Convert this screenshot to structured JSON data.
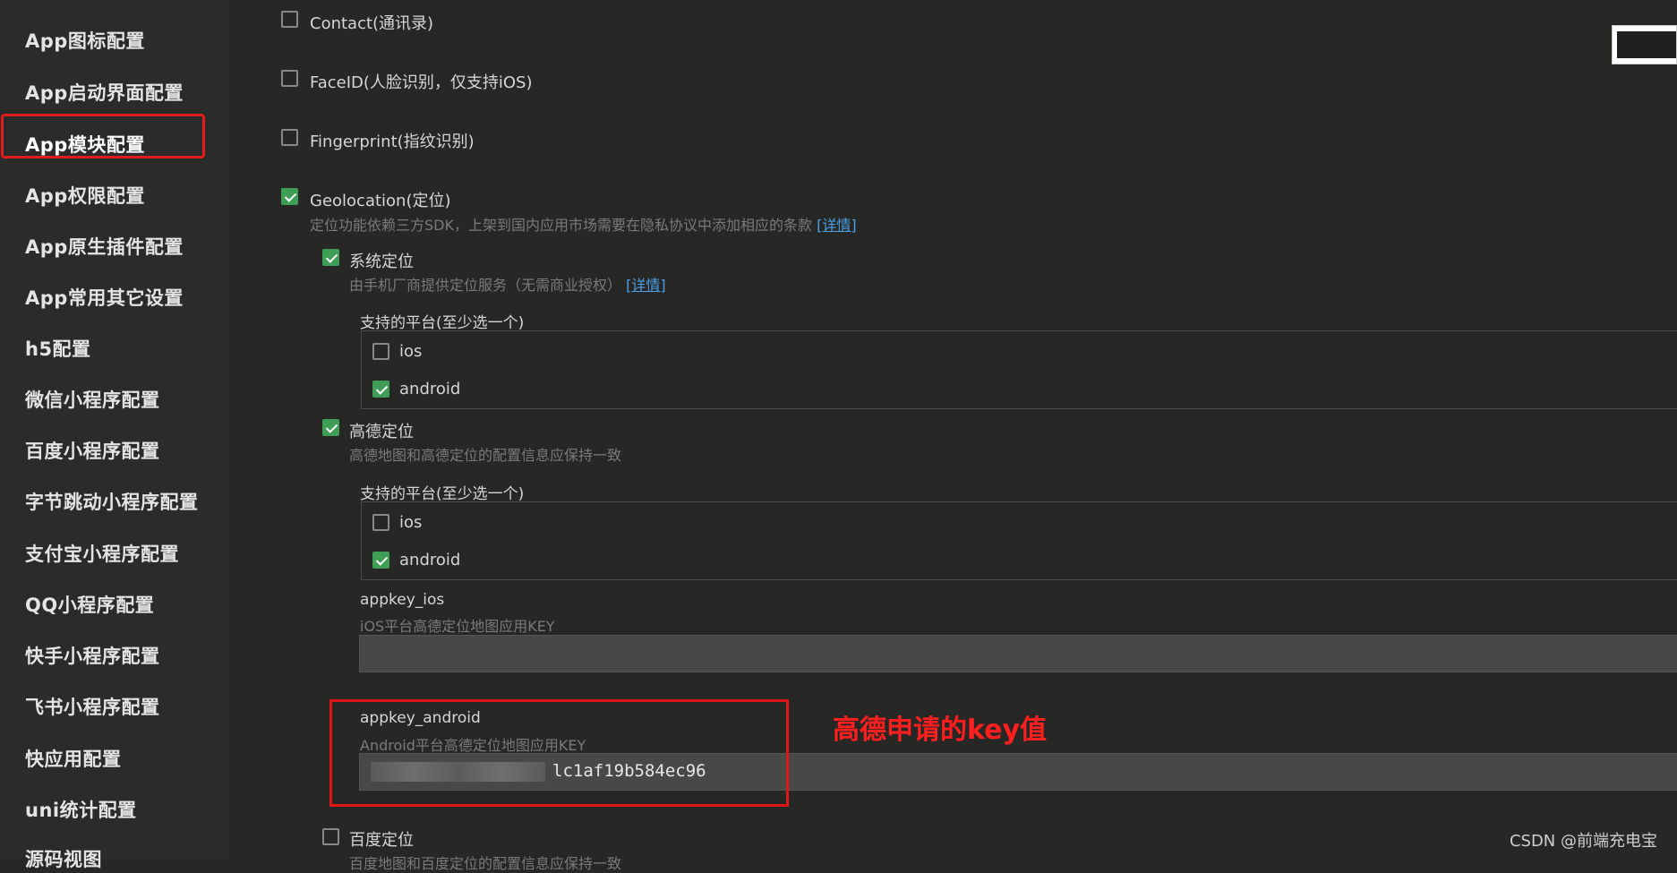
{
  "sidebar": {
    "items": [
      {
        "label": "App图标配置"
      },
      {
        "label": "App启动界面配置"
      },
      {
        "label": "App模块配置"
      },
      {
        "label": "App权限配置"
      },
      {
        "label": "App原生插件配置"
      },
      {
        "label": "App常用其它设置"
      },
      {
        "label": "h5配置"
      },
      {
        "label": "微信小程序配置"
      },
      {
        "label": "百度小程序配置"
      },
      {
        "label": "字节跳动小程序配置"
      },
      {
        "label": "支付宝小程序配置"
      },
      {
        "label": "QQ小程序配置"
      },
      {
        "label": "快手小程序配置"
      },
      {
        "label": "飞书小程序配置"
      },
      {
        "label": "快应用配置"
      },
      {
        "label": "uni统计配置"
      },
      {
        "label": "源码视图"
      }
    ]
  },
  "modules": {
    "contact": {
      "label": "Contact(通讯录)",
      "checked": false
    },
    "faceid": {
      "label": "FaceID(人脸识别，仅支持iOS)",
      "checked": false
    },
    "fingerprint": {
      "label": "Fingerprint(指纹识别)",
      "checked": false
    },
    "geolocation": {
      "label": "Geolocation(定位)",
      "checked": true,
      "desc": "定位功能依赖三方SDK，上架到国内应用市场需要在隐私协议中添加相应的条款",
      "link": "[详情]"
    }
  },
  "system_location": {
    "label": "系统定位",
    "checked": true,
    "desc": "由手机厂商提供定位服务（无需商业授权）",
    "link": "[详情]",
    "platforms_title": "支持的平台(至少选一个)",
    "ios": {
      "label": "ios",
      "checked": false
    },
    "android": {
      "label": "android",
      "checked": true
    }
  },
  "amap_location": {
    "label": "高德定位",
    "checked": true,
    "desc": "高德地图和高德定位的配置信息应保持一致",
    "platforms_title": "支持的平台(至少选一个)",
    "ios": {
      "label": "ios",
      "checked": false
    },
    "android": {
      "label": "android",
      "checked": true
    },
    "appkey_ios": {
      "label": "appkey_ios",
      "desc": "iOS平台高德定位地图应用KEY",
      "value": ""
    },
    "appkey_android": {
      "label": "appkey_android",
      "desc": "Android平台高德定位地图应用KEY",
      "value": "lc1af19b584ec96"
    }
  },
  "baidu_location": {
    "label": "百度定位",
    "checked": false,
    "desc": "百度地图和百度定位的配置信息应保持一致"
  },
  "annotation": {
    "text": "高德申请的key值",
    "color": "#ff1f1f"
  },
  "watermark": "CSDN @前端充电宝",
  "colors": {
    "accent": "#3e9e55",
    "link": "#4a9fe8",
    "highlight": "#e11c1c"
  }
}
